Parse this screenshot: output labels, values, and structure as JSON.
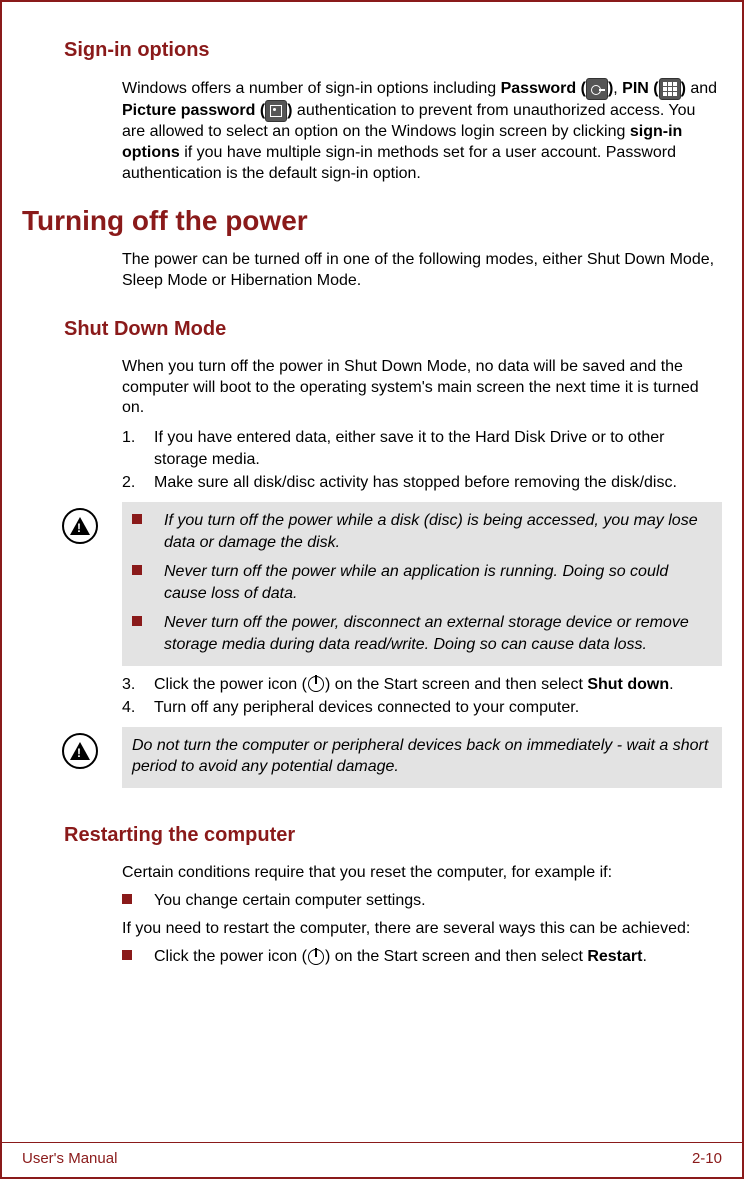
{
  "sec_signin": {
    "heading": "Sign-in options",
    "p1a": "Windows offers a number of sign-in options including ",
    "p1_pw": "Password (",
    "p1b": ")",
    "p1c": ", ",
    "p1_pin": "PIN (",
    "p1d": ")",
    "p1e": " and ",
    "p1_pic": "Picture password (",
    "p1f": ")",
    "p1g": " authentication to prevent from unauthorized access. You are allowed to select an option on the Windows login screen by clicking ",
    "p1_sio": "sign-in options",
    "p1h": " if you have multiple sign-in methods set for a user account. Password authentication is the default sign-in option."
  },
  "sec_power": {
    "heading": "Turning off the power",
    "p1": "The power can be turned off in one of the following modes, either Shut Down Mode, Sleep Mode or Hibernation Mode."
  },
  "sec_shutdown": {
    "heading": "Shut Down Mode",
    "p1": "When you turn off the power in Shut Down Mode, no data will be saved and the computer will boot to the operating system's main screen the next time it is turned on.",
    "ol1_num": "1.",
    "ol1_txt": "If you have entered data, either save it to the Hard Disk Drive or to other storage media.",
    "ol2_num": "2.",
    "ol2_txt": "Make sure all disk/disc activity has stopped before removing the disk/disc.",
    "warn1_b1": "If you turn off the power while a disk (disc) is being accessed, you may lose data or damage the disk.",
    "warn1_b2": "Never turn off the power while an application is running. Doing so could cause loss of data.",
    "warn1_b3": "Never turn off the power, disconnect an external storage device or remove storage media during data read/write. Doing so can cause data loss.",
    "ol3_num": "3.",
    "ol3_a": "Click the power icon (",
    "ol3_b": ") on the Start screen and then select ",
    "ol3_bold": "Shut down",
    "ol3_c": ".",
    "ol4_num": "4.",
    "ol4_txt": "Turn off any peripheral devices connected to your computer.",
    "warn2": "Do not turn the computer or peripheral devices back on immediately - wait a short period to avoid any potential damage."
  },
  "sec_restart": {
    "heading": "Restarting the computer",
    "p1": "Certain conditions require that you reset the computer, for example if:",
    "b1": "You change certain computer settings.",
    "p2": "If you need to restart the computer, there are several ways this can be achieved:",
    "b2a": "Click the power icon (",
    "b2b": ") on the Start screen and then select ",
    "b2_bold": "Restart",
    "b2c": "."
  },
  "footer": {
    "left": "User's Manual",
    "right": "2-10"
  }
}
